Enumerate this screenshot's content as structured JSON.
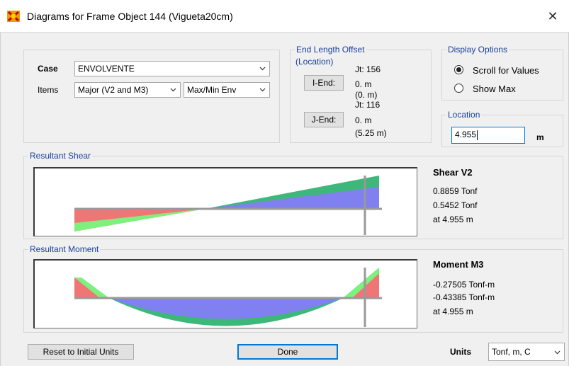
{
  "window": {
    "title": "Diagrams for Frame Object 144  (Vigueta20cm)",
    "close_glyph": "✕",
    "icon": "etabs-app-icon"
  },
  "case": {
    "label": "Case",
    "value": "ENVOLVENTE"
  },
  "items": {
    "label": "Items",
    "component_value": "Major (V2 and M3)",
    "envelope_value": "Max/Min Env"
  },
  "end_length_offset": {
    "legend": "End Length Offset",
    "sub_legend": "(Location)",
    "i_end": {
      "button_label": "I-End:",
      "joint": "Jt:  156",
      "offset": "0. m",
      "location": "(0. m)"
    },
    "j_end": {
      "button_label": "J-End:",
      "joint": "Jt:  116",
      "offset": "0. m",
      "location": "(5.25 m)"
    }
  },
  "display_options": {
    "legend": "Display Options",
    "options": [
      {
        "label": "Scroll for Values",
        "selected": true
      },
      {
        "label": "Show Max",
        "selected": false
      }
    ]
  },
  "location": {
    "legend": "Location",
    "value": "4.955",
    "unit": "m"
  },
  "shear": {
    "legend": "Resultant Shear",
    "heading": "Shear V2",
    "value_max": "0.8859 Tonf",
    "value_min": "0.5452 Tonf",
    "at": "at 4.955 m"
  },
  "moment": {
    "legend": "Resultant Moment",
    "heading": "Moment M3",
    "value_max": "-0.27505 Tonf-m",
    "value_min": "-0.43385 Tonf-m",
    "at": "at 4.955 m"
  },
  "footer": {
    "reset_label": "Reset to Initial Units",
    "done_label": "Done",
    "units_label": "Units",
    "units_value": "Tonf, m, C"
  },
  "colors": {
    "positive_fill": "#3eb87a",
    "negative_fill": "#f07676",
    "overlap_fill": "#8080f0",
    "bright_green": "#7df07d",
    "accent_blue": "#1a3f9e"
  }
}
